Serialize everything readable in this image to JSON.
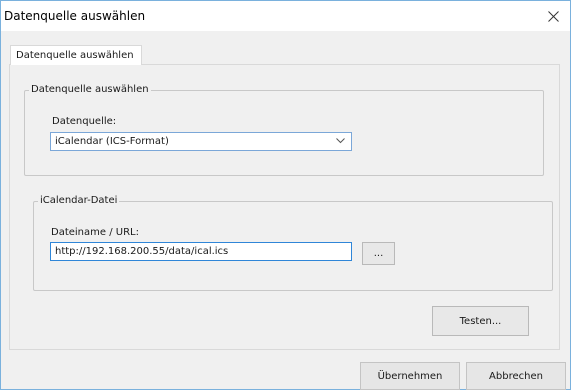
{
  "window": {
    "title": "Datenquelle auswählen",
    "close_glyph": "✕"
  },
  "tabs": [
    {
      "label": "Datenquelle auswählen"
    }
  ],
  "group_source": {
    "legend": "Datenquelle auswählen",
    "label": "Datenquelle:",
    "selected": "iCalendar (ICS-Format)"
  },
  "group_file": {
    "legend": "iCalendar-Datei",
    "label": "Dateiname / URL:",
    "value": "http://192.168.200.55/data/ical.ics",
    "browse_label": "..."
  },
  "buttons": {
    "test": "Testen...",
    "apply": "Übernehmen",
    "cancel": "Abbrechen"
  },
  "colors": {
    "window_border": "#7ab1dd",
    "input_focus": "#2f86d8",
    "background": "#f0f0f0"
  },
  "icons": {
    "close": "close-icon",
    "dropdown": "chevron-down-icon"
  }
}
